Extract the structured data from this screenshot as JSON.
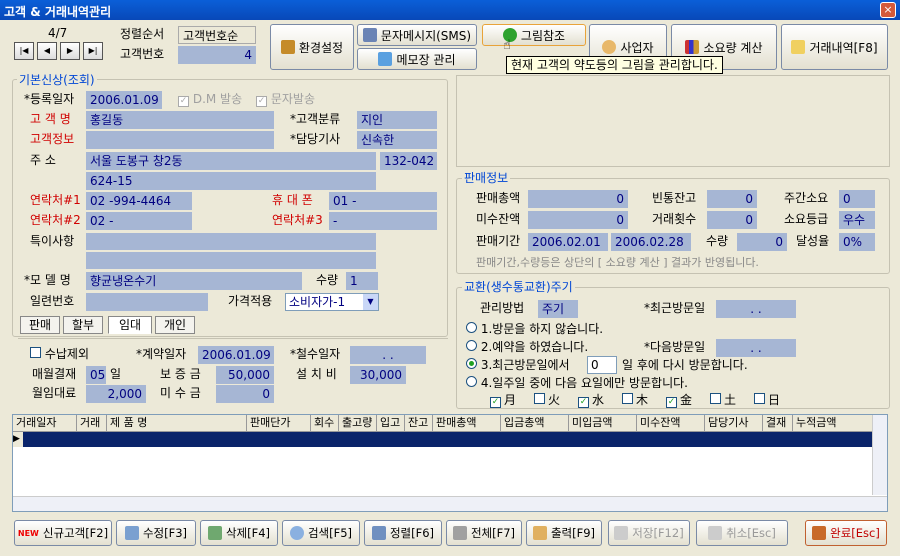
{
  "window": {
    "title": "고객 & 거래내역관리",
    "close": "×"
  },
  "nav": {
    "counter": "4/7",
    "first": "|◀",
    "prev": "◀",
    "next": "▶",
    "last": "▶|"
  },
  "sort": {
    "order_label": "정렬순서",
    "order_value": "고객번호순",
    "custno_label": "고객번호",
    "custno_value": "4"
  },
  "toolbar": {
    "settings": "환경설정",
    "sms": "문자메시지(SMS)",
    "memo": "메모장 관리",
    "picture": "그림참조",
    "business": "사업자",
    "usage": "소요량 계산",
    "history": "거래내역[F8]"
  },
  "tooltip": "현재 고객의 약도등의 그림을 관리합니다.",
  "basic": {
    "title": "기본신상(조회)",
    "reg_date_label": "*등록일자",
    "reg_date": "2006.01.09",
    "dm_label": "D.M 발송",
    "sms_label": "문자발송",
    "name_label": "고 객 명",
    "name": "홍길동",
    "category_label": "*고객분류",
    "category": "지인",
    "info_label": "고객정보",
    "info": "",
    "tech_label": "*담당기사",
    "tech": "신속한",
    "addr_label": "주      소",
    "addr1": "서울 도봉구 창2동",
    "zip": "132-042",
    "addr2": "624-15",
    "contact1_label": "연락처#1",
    "contact1": "02  -994-4464",
    "mobile_label": "휴 대 폰",
    "mobile": "01 -",
    "contact2_label": "연락처#2",
    "contact2": "02  -",
    "contact3_label": "연락처#3",
    "contact3": "-",
    "notes_label": "특이사항",
    "notes1": "",
    "notes2": "",
    "model_label": "*모 델 명",
    "model": "향균냉온수기",
    "qty_label": "수량",
    "qty": "1",
    "serial_label": "일련번호",
    "serial": "",
    "price_label": "가격적용",
    "price": "소비자가-1"
  },
  "tabs": [
    "판매",
    "할부",
    "임대",
    "개인"
  ],
  "contract": {
    "collect_ex_label": "수납제외",
    "contract_date_label": "*계약일자",
    "contract_date": "2006.01.09",
    "removal_label": "*철수일자",
    "removal": ".   .",
    "monthly_label": "매월결재",
    "monthly_day": "05",
    "day_unit": "일",
    "deposit_label": "보 증 금",
    "deposit": "50,000",
    "install_label": "설 치 비",
    "install": "30,000",
    "rent_label": "월임대료",
    "rent": "2,000",
    "unpaid_label": "미 수 금",
    "unpaid": "0"
  },
  "sales": {
    "title": "판매정보",
    "total_label": "판매총액",
    "total": "0",
    "empty_label": "빈통잔고",
    "empty": "0",
    "weekly_label": "주간소요",
    "weekly": "0",
    "unpaid_label": "미수잔액",
    "unpaid": "0",
    "count_label": "거래횟수",
    "count": "0",
    "grade_label": "소요등급",
    "grade": "우수",
    "period_label": "판매기간",
    "from": "2006.02.01",
    "to": "2006.02.28",
    "qty_label": "수량",
    "qty": "0",
    "rate_label": "달성율",
    "rate": "0%",
    "note": "판매기간,수량등은 상단의 [ 소요량 계산 ] 결과가 반영됩니다."
  },
  "exchange": {
    "title": "교환(생수통교환)주기",
    "method_label": "관리방법",
    "method": "주기",
    "last_visit_label": "*최근방문일",
    "last_visit": ".   .",
    "opt1": "1.방문을 하지 않습니다.",
    "opt2": "2.예약을 하였습니다.",
    "next_visit_label": "*다음방문일",
    "next_visit": ".   .",
    "opt3a": "3.최근방문일에서",
    "opt3_days": "0",
    "opt3b": "일 후에 다시 방문합니다.",
    "opt4": "4.일주일 중에 다음 요일에만 방문합니다.",
    "days": [
      {
        "label": "月",
        "checked": true
      },
      {
        "label": "火",
        "checked": false
      },
      {
        "label": "水",
        "checked": true
      },
      {
        "label": "木",
        "checked": false
      },
      {
        "label": "金",
        "checked": true
      },
      {
        "label": "土",
        "checked": false
      },
      {
        "label": "日",
        "checked": false
      }
    ]
  },
  "table": {
    "headers": [
      "거래일자",
      "거래",
      "제   품   명",
      "판매단가",
      "회수",
      "출고량",
      "입고",
      "잔고",
      "판매총액",
      "입금총액",
      "미입금액",
      "미수잔액",
      "담당기사",
      "결재",
      "누적금액"
    ]
  },
  "bottom": {
    "new": "신규고객[F2]",
    "edit": "수정[F3]",
    "delete": "삭제[F4]",
    "search": "검색[F5]",
    "sort": "정렬[F6]",
    "all": "전체[F7]",
    "print": "출력[F9]",
    "save": "저장[F12]",
    "cancel": "취소[Esc]",
    "done": "완료[Esc]",
    "new_badge": "NEW"
  }
}
